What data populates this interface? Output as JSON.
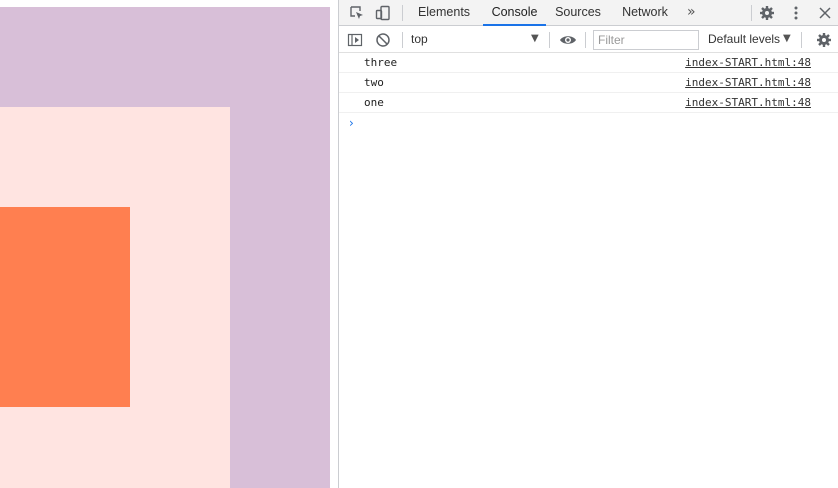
{
  "page": {
    "colors": {
      "outer": "#d8bfd8",
      "middle": "#ffe4e1",
      "inner": "#ff7f50"
    }
  },
  "devtools": {
    "tabs": [
      {
        "label": "Elements",
        "active": false
      },
      {
        "label": "Console",
        "active": true
      },
      {
        "label": "Sources",
        "active": false
      },
      {
        "label": "Network",
        "active": false
      }
    ],
    "more_tabs_label": "»",
    "icons": [
      "inspect-element-icon",
      "device-toolbar-icon",
      "settings-gear-icon",
      "more-options-icon",
      "close-icon"
    ],
    "console_toolbar": {
      "context": "top",
      "filter_placeholder": "Filter",
      "filter_value": "",
      "levels": "Default levels",
      "icons": [
        "show-sidebar-icon",
        "clear-console-icon",
        "live-expression-eye-icon",
        "console-settings-gear-icon"
      ]
    },
    "messages": [
      {
        "text": "three",
        "source": "index-START.html:48"
      },
      {
        "text": "two",
        "source": "index-START.html:48"
      },
      {
        "text": "one",
        "source": "index-START.html:48"
      }
    ],
    "prompt_symbol": "›",
    "accent_color": "#1a73e8"
  }
}
